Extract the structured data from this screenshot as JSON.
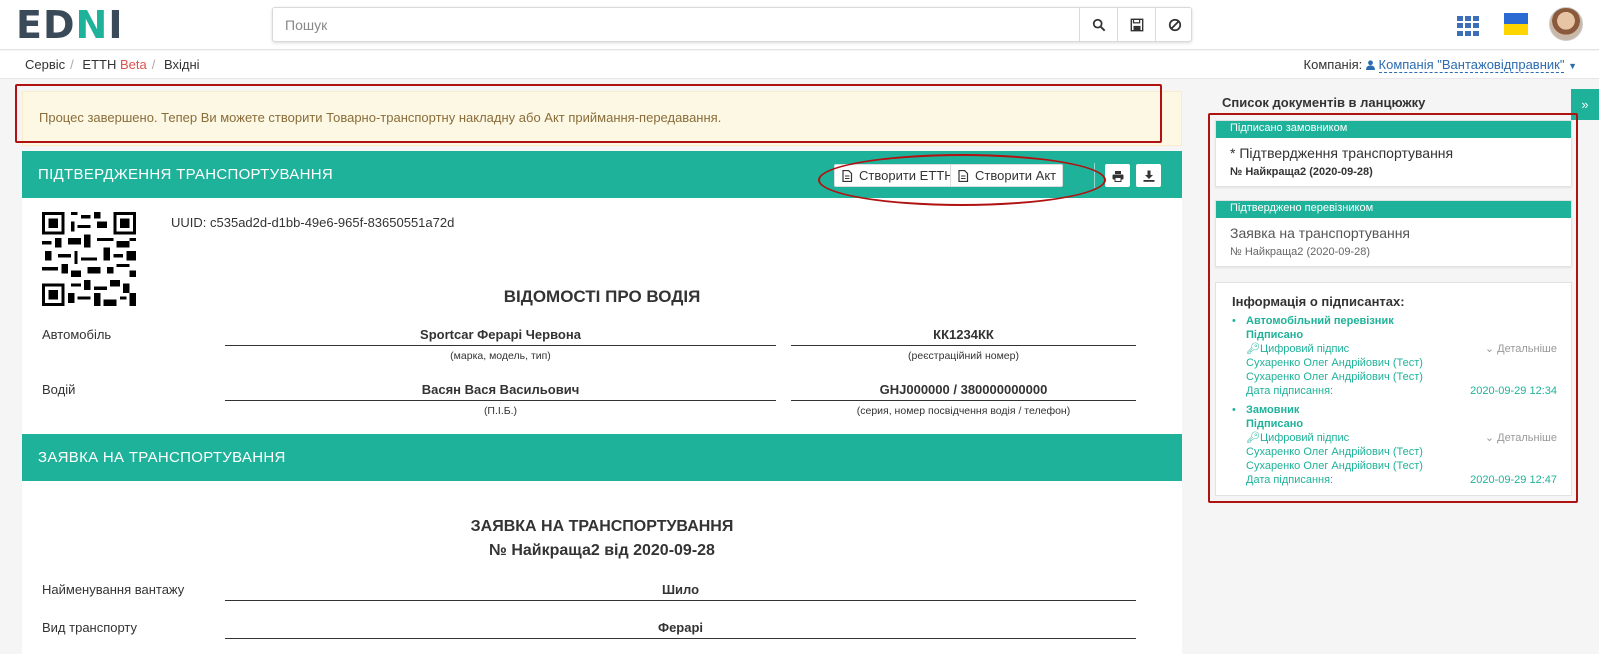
{
  "header": {
    "logo_part1": "ED",
    "logo_part2": "N",
    "logo_part3": "I",
    "search_placeholder": "Пошук",
    "search_icon": "search-icon",
    "save_icon": "save-icon",
    "clear_icon": "ban-icon",
    "apps_icon": "apps-grid-icon",
    "flag_icon": "ukraine-flag-icon",
    "accent_color": "#1fb29a",
    "brand_dark": "#3a4a59"
  },
  "breadcrumb": {
    "items": [
      "Сервіс",
      "ЕТТН",
      "Вхідні"
    ],
    "beta": "Beta",
    "company_label": "Компанія:",
    "company_name": "Компанія \"Вантажовідправник\""
  },
  "alert": {
    "text": "Процес завершено. Тепер Ви можете створити Товарно-транспортну накладну або Акт приймання-передавання."
  },
  "main": {
    "title": "ПІДТВЕРДЖЕННЯ ТРАНСПОРТУВАННЯ",
    "create_etth": "Створити ЕТТН",
    "create_act": "Створити Акт",
    "print_icon": "print-icon",
    "download_icon": "download-icon",
    "uuid": "UUID: c535ad2d-d1bb-49e6-965f-83650551a72d",
    "driver_section_title": "ВІДОМОСТІ ПРО ВОДІЯ",
    "car_label": "Автомобіль",
    "car_value": "Sportcar Ферарі Червона",
    "car_hint": "(марка, модель, тип)",
    "reg_value": "КК1234КК",
    "reg_hint": "(реєстраційний номер)",
    "driver_label": "Водій",
    "driver_value": "Васян Вася Васильович",
    "driver_hint": "(П.І.Б.)",
    "license_value": "GHJ000000 / 380000000000",
    "license_hint": "(серия, номер посвідчення водія / телефон)"
  },
  "request": {
    "section_title": "ЗАЯВКА НА ТРАНСПОРТУВАННЯ",
    "doc_title": "ЗАЯВКА НА ТРАНСПОРТУВАННЯ",
    "doc_number": "№ Найкраща2 від 2020-09-28",
    "cargo_label": "Найменування вантажу",
    "cargo_value": "Шило",
    "transport_label": "Вид транспорту",
    "transport_value": "Ферарі"
  },
  "chain": {
    "title": "Список документів в ланцюжку",
    "toggle": "»",
    "docs": [
      {
        "badge": "Підписано замовником",
        "title": "* Підтвердження транспортування",
        "number": "№ Найкраща2 (2020-09-28)"
      },
      {
        "badge": "Підтверджено перевізником",
        "title": "Заявка на транспортування",
        "number": "№ Найкраща2 (2020-09-28)"
      }
    ]
  },
  "signers": {
    "title": "Інформація о підписантах:",
    "list": [
      {
        "role": "Автомобільний перевізник",
        "status": "Підписано",
        "sig_type": "Цифровий підпис",
        "details": "Детальніше",
        "name1": "Сухаренко Олег Андрійович (Тест)",
        "name2": "Сухаренко Олег Андрійович (Тест)",
        "date_label": "Дата підписання:",
        "date": "2020-09-29 12:34"
      },
      {
        "role": "Замовник",
        "status": "Підписано",
        "sig_type": "Цифровий підпис",
        "details": "Детальніше",
        "name1": "Сухаренко Олег Андрійович (Тест)",
        "name2": "Сухаренко Олег Андрійович (Тест)",
        "date_label": "Дата підписання:",
        "date": "2020-09-29 12:47"
      }
    ]
  }
}
